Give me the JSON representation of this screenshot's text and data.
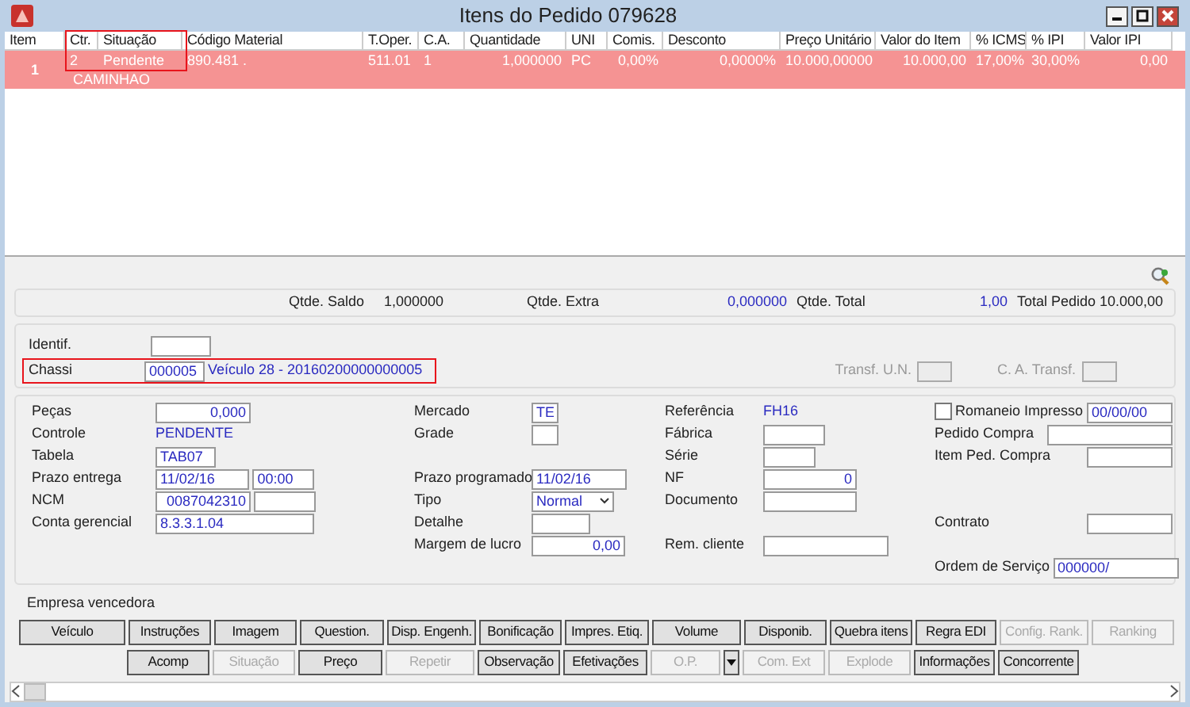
{
  "window": {
    "title": "Itens do Pedido 079628"
  },
  "table": {
    "columns": [
      {
        "label": "Item",
        "highlight": false
      },
      {
        "label": "Ctr.",
        "highlight": true
      },
      {
        "label": "Situação",
        "highlight": true
      },
      {
        "label": "Código Material",
        "highlight": false
      },
      {
        "label": "T.Oper.",
        "highlight": false
      },
      {
        "label": "C.A.",
        "highlight": false
      },
      {
        "label": "Quantidade",
        "highlight": false
      },
      {
        "label": "UNI",
        "highlight": false
      },
      {
        "label": "Comis.",
        "highlight": false
      },
      {
        "label": "Desconto",
        "highlight": false
      },
      {
        "label": "Preço Unitário",
        "highlight": false
      },
      {
        "label": "Valor do Item",
        "highlight": false
      },
      {
        "label": "% ICMS",
        "highlight": false
      },
      {
        "label": "% IPI",
        "highlight": false
      },
      {
        "label": "Valor IPI",
        "highlight": false
      }
    ],
    "rows": [
      {
        "selected": true,
        "cells": [
          "1",
          "2",
          "Pendente",
          "890.481 .",
          "511.01",
          "1",
          "1,000000",
          "PC",
          "0,00%",
          "0,0000%",
          "10.000,00000",
          "10.000,00",
          "17,00%",
          "30,00%",
          "0,00"
        ],
        "note": "CAMINHAO"
      }
    ]
  },
  "summary": [
    {
      "label": "Qtde. Saldo",
      "value": "1,000000",
      "blue": false
    },
    {
      "label": "Qtde. Extra",
      "value": "0,000000",
      "blue": true
    },
    {
      "label": "Qtde. Total",
      "value": "1,00",
      "blue": true
    },
    {
      "label": "Total Pedido",
      "value": "10.000,00",
      "blue": false
    }
  ],
  "identification": {
    "identif": {
      "label": "Identif."
    },
    "chassi": {
      "label": "Chassi",
      "value": "000005",
      "description": "Veículo 28 - 20160200000000005",
      "highlight": true
    },
    "transfer": [
      {
        "label": "Transf. U.N.",
        "disabled": true
      },
      {
        "label": "C. A. Transf.",
        "disabled": true
      }
    ]
  },
  "form": [
    [
      {
        "label": "Peças",
        "kind": "fields",
        "fields": [
          {
            "value": "0,000",
            "numeric": true
          }
        ]
      },
      {
        "label": "Mercado",
        "kind": "fields",
        "fields": [
          {
            "value": "TE"
          }
        ]
      },
      {
        "label": "Referência",
        "kind": "text",
        "text": "FH16"
      },
      {
        "label": "Romaneio Impresso",
        "kind": "checkbox",
        "checked": false,
        "fields": [
          {
            "value": "00/00/00",
            "numeric": false
          }
        ]
      }
    ],
    [
      {
        "label": "Controle",
        "kind": "text",
        "text": "PENDENTE"
      },
      {
        "label": "Grade",
        "kind": "fields",
        "fields": [
          {
            "disabled": false
          }
        ]
      },
      {
        "label": "Fábrica",
        "kind": "fields",
        "fields": [
          {
            "disabled": false
          }
        ]
      },
      {
        "label": "Pedido Compra",
        "kind": "fields",
        "fields": [
          {
            "disabled": false
          }
        ]
      }
    ],
    [
      {
        "label": "Tabela",
        "kind": "fields",
        "fields": [
          {
            "value": "TAB07",
            "numeric": false
          }
        ]
      },
      {
        "kind": "empty"
      },
      {
        "label": "Série",
        "kind": "fields",
        "fields": [
          {
            "disabled": false
          }
        ]
      },
      {
        "label": "Item Ped. Compra",
        "kind": "fields",
        "fields": [
          {
            "disabled": false
          }
        ]
      }
    ],
    [
      {
        "label": "Prazo entrega",
        "kind": "fields",
        "fields": [
          {
            "value": "11/02/16",
            "numeric": false
          },
          {
            "value": "00:00",
            "numeric": false
          }
        ]
      },
      {
        "label": "Prazo programado",
        "kind": "fields",
        "fields": [
          {
            "value": "11/02/16",
            "numeric": false
          }
        ]
      },
      {
        "label": "NF",
        "kind": "fields",
        "fields": [
          {
            "value": "0",
            "numeric": true
          }
        ]
      },
      {
        "kind": "empty"
      }
    ],
    [
      {
        "label": "NCM",
        "kind": "fields",
        "fields": [
          {
            "value": "0087042310",
            "numeric": true
          },
          {
            "disabled": false
          }
        ]
      },
      {
        "label": "Tipo",
        "kind": "select",
        "value": "Normal"
      },
      {
        "label": "Documento",
        "kind": "fields",
        "fields": [
          {
            "disabled": false
          }
        ]
      },
      {
        "kind": "empty"
      }
    ],
    [
      {
        "label": "Conta gerencial",
        "kind": "fields",
        "fields": [
          {
            "value": "8.3.3.1.04",
            "numeric": false
          }
        ]
      },
      {
        "label": "Detalhe",
        "kind": "fields",
        "fields": [
          {
            "disabled": false
          }
        ]
      },
      {
        "kind": "empty"
      },
      {
        "label": "Contrato",
        "kind": "fields",
        "fields": [
          {
            "disabled": false
          }
        ]
      }
    ],
    [
      {
        "kind": "empty"
      },
      {
        "label": "Margem de lucro",
        "kind": "fields",
        "fields": [
          {
            "value": "0,00",
            "numeric": true
          }
        ]
      },
      {
        "label": "Rem. cliente",
        "kind": "fields",
        "fields": [
          {
            "disabled": false
          }
        ]
      },
      {
        "kind": "empty"
      }
    ],
    [
      {
        "kind": "empty"
      },
      {
        "kind": "empty"
      },
      {
        "kind": "empty"
      },
      {
        "label": "Ordem de Serviço",
        "kind": "fields",
        "fields": [
          {
            "value": "000000/",
            "numeric": false
          }
        ]
      }
    ]
  ],
  "section_label": "Empresa vencedora",
  "button_rows": [
    [
      {
        "kind": "button",
        "label": "Veículo",
        "disabled": false
      },
      {
        "kind": "button",
        "label": "Instruções",
        "disabled": false
      },
      {
        "kind": "button",
        "label": "Imagem",
        "disabled": false
      },
      {
        "kind": "button",
        "label": "Question.",
        "disabled": false
      },
      {
        "kind": "button",
        "label": "Disp. Engenh.",
        "disabled": false
      },
      {
        "kind": "button",
        "label": "Bonificação",
        "disabled": false
      },
      {
        "kind": "button",
        "label": "Impres. Etiq.",
        "disabled": false
      },
      {
        "kind": "button",
        "label": "Volume",
        "disabled": false
      },
      {
        "kind": "button",
        "label": "Disponib.",
        "disabled": false
      },
      {
        "kind": "button",
        "label": "Quebra itens",
        "disabled": false
      },
      {
        "kind": "button",
        "label": "Regra EDI",
        "disabled": false
      },
      {
        "kind": "button",
        "label": "Config. Rank.",
        "disabled": true
      },
      {
        "kind": "button",
        "label": "Ranking",
        "disabled": true
      }
    ],
    [
      {
        "kind": "button",
        "label": "Acomp",
        "disabled": false
      },
      {
        "kind": "button",
        "label": "Situação",
        "disabled": true
      },
      {
        "kind": "button",
        "label": "Preço",
        "disabled": false
      },
      {
        "kind": "button",
        "label": "Repetir",
        "disabled": true
      },
      {
        "kind": "button",
        "label": "Observação",
        "disabled": false
      },
      {
        "kind": "button",
        "label": "Efetivações",
        "disabled": false
      },
      {
        "kind": "button",
        "label": "O.P.",
        "disabled": true
      },
      {
        "kind": "dropdown",
        "disabled": false
      },
      {
        "kind": "button",
        "label": "Com. Ext",
        "disabled": true
      },
      {
        "kind": "button",
        "label": "Explode",
        "disabled": true
      },
      {
        "kind": "button",
        "label": "Informações",
        "disabled": false
      },
      {
        "kind": "button",
        "label": "Concorrente",
        "disabled": false
      }
    ]
  ]
}
